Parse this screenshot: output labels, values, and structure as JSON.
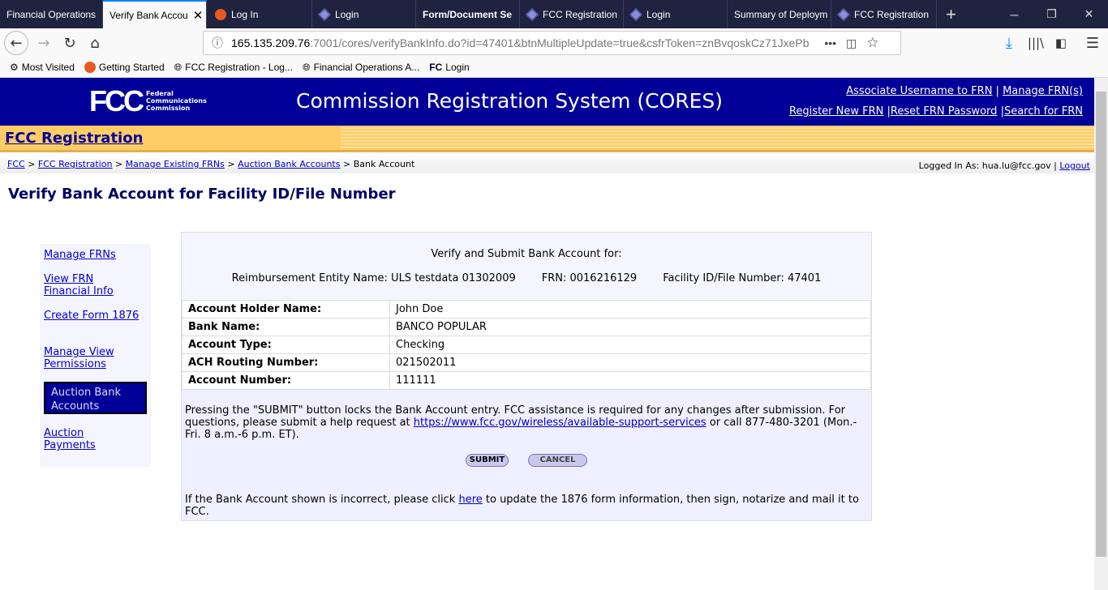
{
  "browser": {
    "tabs": [
      {
        "label": "Financial Operations",
        "icon": "none"
      },
      {
        "label": "Verify Bank Accou",
        "icon": "none",
        "active": true
      },
      {
        "label": "Log In",
        "icon": "firefox-like"
      },
      {
        "label": "Login",
        "icon": "diamond"
      },
      {
        "label": "Form/Document Se",
        "icon": "none"
      },
      {
        "label": "FCC Registration",
        "icon": "diamond"
      },
      {
        "label": "Login",
        "icon": "diamond"
      },
      {
        "label": "Summary of Deploym",
        "icon": "none"
      },
      {
        "label": "FCC Registration",
        "icon": "diamond"
      }
    ],
    "url_host": "165.135.209.76",
    "url_rest": ":7001/cores/verifyBankInfo.do?id=47401&btnMultipleUpdate=true&csfrToken=znBvqoskCz71JxePb",
    "bookmarks": [
      "Most Visited",
      "Getting Started",
      "FCC Registration - Log...",
      "Financial Operations A...",
      "Login"
    ]
  },
  "header": {
    "logo_text": "FCC",
    "logo_sub": [
      "Federal",
      "Communications",
      "Commission"
    ],
    "title": "Commission Registration System (CORES)",
    "links_top": [
      "Associate Username to FRN",
      "Manage FRN(s)"
    ],
    "links_bottom": [
      "Register New FRN",
      "Reset FRN Password",
      "Search for FRN"
    ]
  },
  "band_title": "FCC Registration",
  "breadcrumb": {
    "links": [
      "FCC",
      "FCC Registration",
      "Manage Existing FRNs",
      "Auction Bank Accounts"
    ],
    "current": "Bank Account"
  },
  "login": {
    "label": "Logged In As: hua.lu@fcc.gov",
    "logout": "Logout"
  },
  "page_title": "Verify Bank Account for Facility ID/File Number",
  "sidebar": {
    "items": [
      "Manage FRNs",
      "View FRN",
      "Financial Info",
      "Create Form 1876",
      "Manage View",
      "Permissions",
      "Auction Bank",
      "Accounts",
      "Auction",
      "Payments"
    ]
  },
  "main": {
    "heading": "Verify and Submit Bank Account for:",
    "entity": "Reimbursement Entity Name: ULS testdata 01302009",
    "frn": "FRN: 0016216129",
    "facility": "Facility ID/File Number: 47401",
    "rows": [
      {
        "k": "Account Holder Name:",
        "v": "John Doe"
      },
      {
        "k": "Bank Name:",
        "v": "BANCO POPULAR"
      },
      {
        "k": "Account Type:",
        "v": "Checking"
      },
      {
        "k": "ACH Routing Number:",
        "v": "021502011"
      },
      {
        "k": "Account Number:",
        "v": "111111"
      }
    ],
    "note_a": "Pressing the \"SUBMIT\" button locks the Bank Account entry. FCC assistance is required for any changes after submission. For questions, please submit a help request at ",
    "note_link": "https://www.fcc.gov/wireless/available-support-services",
    "note_b": " or call 877-480-3201 (Mon.-Fri. 8 a.m.-6 p.m. ET).",
    "submit": "SUBMIT",
    "cancel": "CANCEL",
    "foot_a": "If the Bank Account shown is incorrect, please click ",
    "foot_link": "here",
    "foot_b": " to update the 1876 form information, then sign, notarize and mail it to FCC."
  }
}
